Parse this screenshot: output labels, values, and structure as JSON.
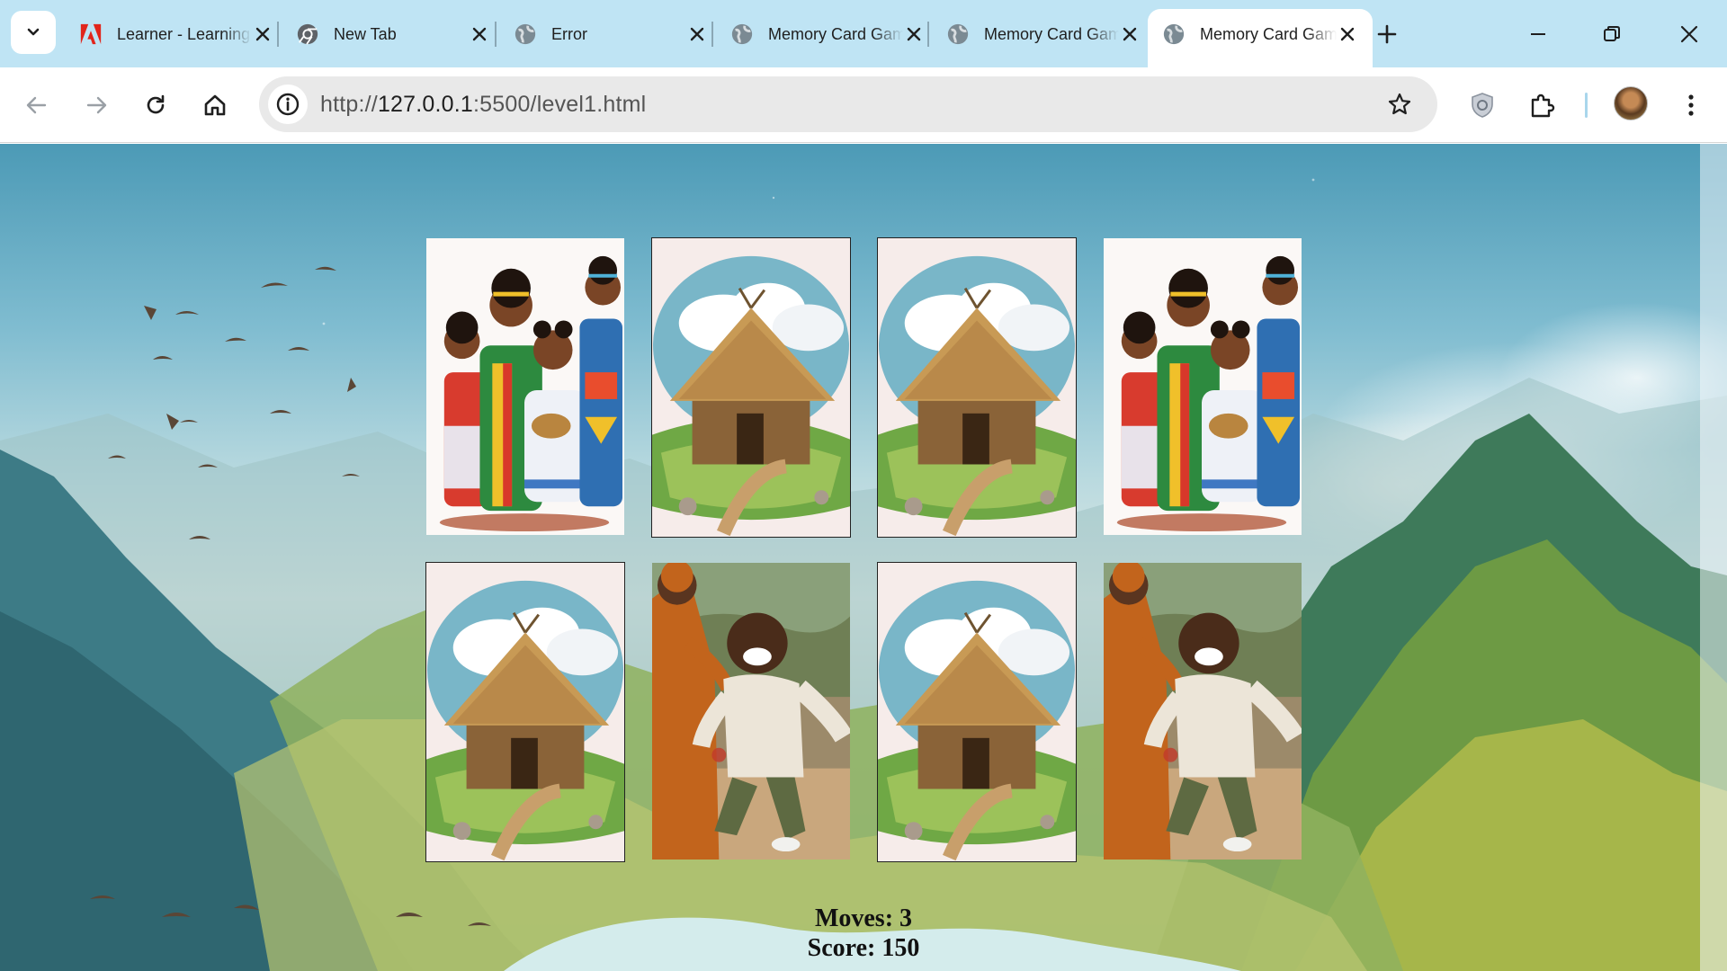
{
  "tabs": [
    {
      "title": "Learner - Learning",
      "favicon": "adobe-icon",
      "active": false
    },
    {
      "title": "New Tab",
      "favicon": "chrome-icon",
      "active": false
    },
    {
      "title": "Error",
      "favicon": "globe-icon",
      "active": false
    },
    {
      "title": "Memory Card Game",
      "favicon": "globe-icon",
      "active": false
    },
    {
      "title": "Memory Card Game",
      "favicon": "globe-icon",
      "active": false
    },
    {
      "title": "Memory Card Game",
      "favicon": "globe-icon",
      "active": true
    }
  ],
  "toolbar": {
    "url_scheme": "http://",
    "url_host": "127.0.0.1",
    "url_rest": ":5500/level1.html"
  },
  "game": {
    "cards": [
      {
        "image": "girls-in-traditional-dress",
        "face_up": true
      },
      {
        "image": "thatched-hut",
        "face_up": true
      },
      {
        "image": "thatched-hut",
        "face_up": true
      },
      {
        "image": "girls-in-traditional-dress",
        "face_up": true
      },
      {
        "image": "thatched-hut",
        "face_up": true
      },
      {
        "image": "boy-running-with-mother",
        "face_up": true
      },
      {
        "image": "thatched-hut",
        "face_up": true
      },
      {
        "image": "boy-running-with-mother",
        "face_up": true
      }
    ],
    "moves_text": "Moves: 3",
    "score_text": "Score: 150",
    "moves": 3,
    "score": 150
  },
  "colors": {
    "tabstrip": "#bfe4f4",
    "omnibox": "#e9e9e9"
  }
}
